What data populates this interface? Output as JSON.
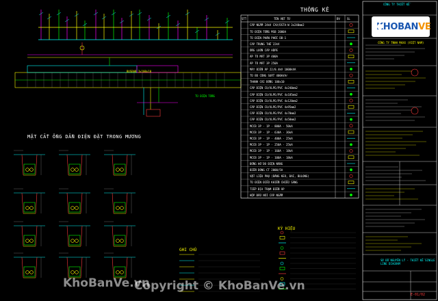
{
  "table": {
    "title": "THỐNG KÊ",
    "header_cols": [
      "STT",
      "TÊN VẬT TƯ",
      "ĐV",
      "SL"
    ],
    "rows": [
      "CÁP NGẦM 24kV CXV/DSTA-W 3x240mm2",
      "TỦ ĐIỆN TỔNG MSB 2000A",
      "TỦ ĐIỆN PHÂN PHỐI DB-1",
      "CÁP TRUNG THẾ 22kV",
      "ỐNG LUỒN CÁP HDPE",
      "ÁP TÔ MÁT 3P 400A",
      "ÁP TÔ MÁT 3P 250A",
      "MÁY BIẾN ÁP 22/0.4kV 1000kVA",
      "TỦ BÙ CÔNG SUẤT 400kVAr",
      "THANH CÁI ĐỒNG 100x10",
      "CÁP ĐIỆN CU/XLPE/PVC 4x240mm2",
      "CÁP ĐIỆN CU/XLPE/PVC 4x185mm2",
      "CÁP ĐIỆN CU/XLPE/PVC 4x120mm2",
      "CÁP ĐIỆN CU/XLPE/PVC 4x95mm2",
      "CÁP ĐIỆN CU/XLPE/PVC 4x70mm2",
      "CÁP ĐIỆN CU/XLPE/PVC 4x50mm2",
      "MCCB 3P - 1P - 800A - 50kA",
      "MCCB 3P - 1P - 630A - 36kA",
      "MCCB 3P - 1P - 400A - 25kA",
      "MCCB 3P - 1P - 250A - 25kA",
      "MCCB 3P - 1P - 160A - 18kA",
      "MCCB 3P - 1P - 100A - 18kA",
      "ĐỒNG HỒ ĐO ĐIỆN NĂNG",
      "BIẾN DÒNG CT 2000/5A",
      "VẬT LIỆU PHỤ (BĂNG KEO, ĐAI, BULONG)",
      "TỦ ĐIỆN ĐIỀU KHIỂN CHIẾU SÁNG",
      "TIẾP ĐỊA TRẠM BIẾN ÁP",
      "HỘP ĐẤU NỐI CÁP NGẦM"
    ]
  },
  "section": {
    "title": "MẶT CẮT ỐNG DẪN ĐIỆN ĐẶT TRONG MƯƠNG"
  },
  "legend": {
    "title": "GHI CHÚ"
  },
  "ky_hieu": {
    "title": "KÝ HIỆU"
  },
  "diagram": {
    "label_tu_dien_tong": "TỦ ĐIỆN TỔNG",
    "label_busbar": "BUSBAR 3x100x10"
  },
  "title_block": {
    "company": "CÔNG TY THIẾT KẾ",
    "project": "CÔNG TY TNHH MAXX (VIỆT NAM)",
    "drawing_title": "SƠ ĐỒ NGUYÊN LÝ - THIẾT KẾ SINGLE LINE DIAGRAM",
    "drawing_no": "E-01/02"
  },
  "logo": {
    "brand_main": "KHOBAN",
    "brand_accent": "VE"
  },
  "watermark": {
    "left": "KhoBanVe.vn",
    "center": "Copyright © KhoBanVe.vn"
  },
  "colors": {
    "background": "#000000",
    "cad_yellow": "#ffff00",
    "cad_cyan": "#00ffff",
    "cad_magenta": "#ff00ff",
    "cad_green": "#00ff00",
    "cad_red": "#ff3b3b",
    "logo_orange": "#f29100",
    "logo_blue": "#1a56b0"
  }
}
